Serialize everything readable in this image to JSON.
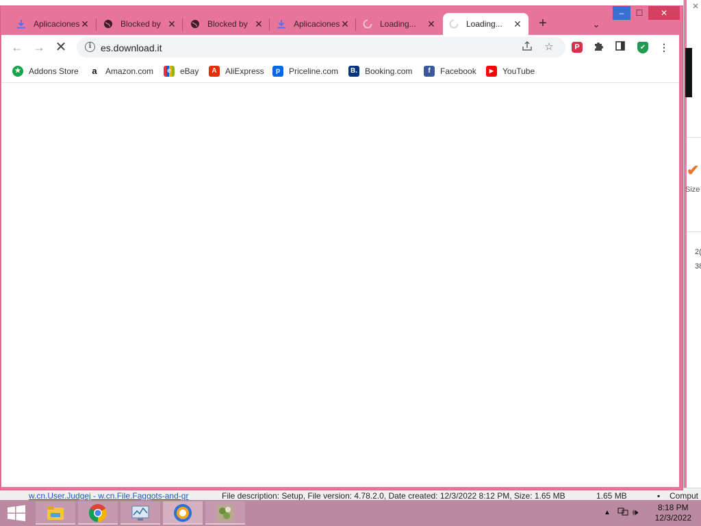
{
  "browser": {
    "tabs": [
      {
        "title": "Aplicaciones",
        "icon": "download-icon"
      },
      {
        "title": "Blocked by",
        "icon": "globe-icon"
      },
      {
        "title": "Blocked by",
        "icon": "globe-icon"
      },
      {
        "title": "Aplicaciones",
        "icon": "download-icon"
      },
      {
        "title": "Loading...",
        "icon": "spinner-icon"
      },
      {
        "title": "Loading...",
        "icon": "spinner-icon",
        "active": true
      }
    ],
    "new_tab_glyph": "+",
    "tab_search_glyph": "⌄",
    "window_controls": {
      "minimize": "–",
      "maximize": "☐",
      "close": "✕"
    },
    "url": "es.download.it",
    "nav": {
      "back": "←",
      "forward": "→",
      "stop": "✕"
    },
    "bookmarks": [
      {
        "label": "Addons Store",
        "icon": "addons-store-icon",
        "color": "#16a34a",
        "glyph": "★"
      },
      {
        "label": "Amazon.com",
        "icon": "amazon-icon",
        "color": "#ffffff",
        "glyph": "a"
      },
      {
        "label": "eBay",
        "icon": "ebay-icon",
        "color": "#f5af02",
        "glyph": "e"
      },
      {
        "label": "AliExpress",
        "icon": "aliexpress-icon",
        "color": "#e62e04",
        "glyph": "A"
      },
      {
        "label": "Priceline.com",
        "icon": "priceline-icon",
        "color": "#0068ef",
        "glyph": "p"
      },
      {
        "label": "Booking.com",
        "icon": "booking-icon",
        "color": "#003580",
        "glyph": "B."
      },
      {
        "label": "Facebook",
        "icon": "facebook-icon",
        "color": "#3b5998",
        "glyph": "f"
      },
      {
        "label": "YouTube",
        "icon": "youtube-icon",
        "color": "#ff0000",
        "glyph": "▶"
      }
    ]
  },
  "background": {
    "status_link": "w.cn.User.Judgej - w.cn.File.Faggots-and-gr",
    "file_description": "File description: Setup, File version: 4.78.2.0, Date created: 12/3/2022 8:12 PM, Size: 1.65 MB",
    "size": "1.65 MB",
    "computer": "Comput",
    "side_size_label": "Size",
    "side_numbers": [
      "2(",
      "38"
    ]
  },
  "taskbar": {
    "apps": [
      "file-explorer",
      "google-chrome",
      "performance-monitor",
      "avast-secure-browser",
      "plant-app"
    ],
    "time": "8:18 PM",
    "date": "12/3/2022"
  }
}
